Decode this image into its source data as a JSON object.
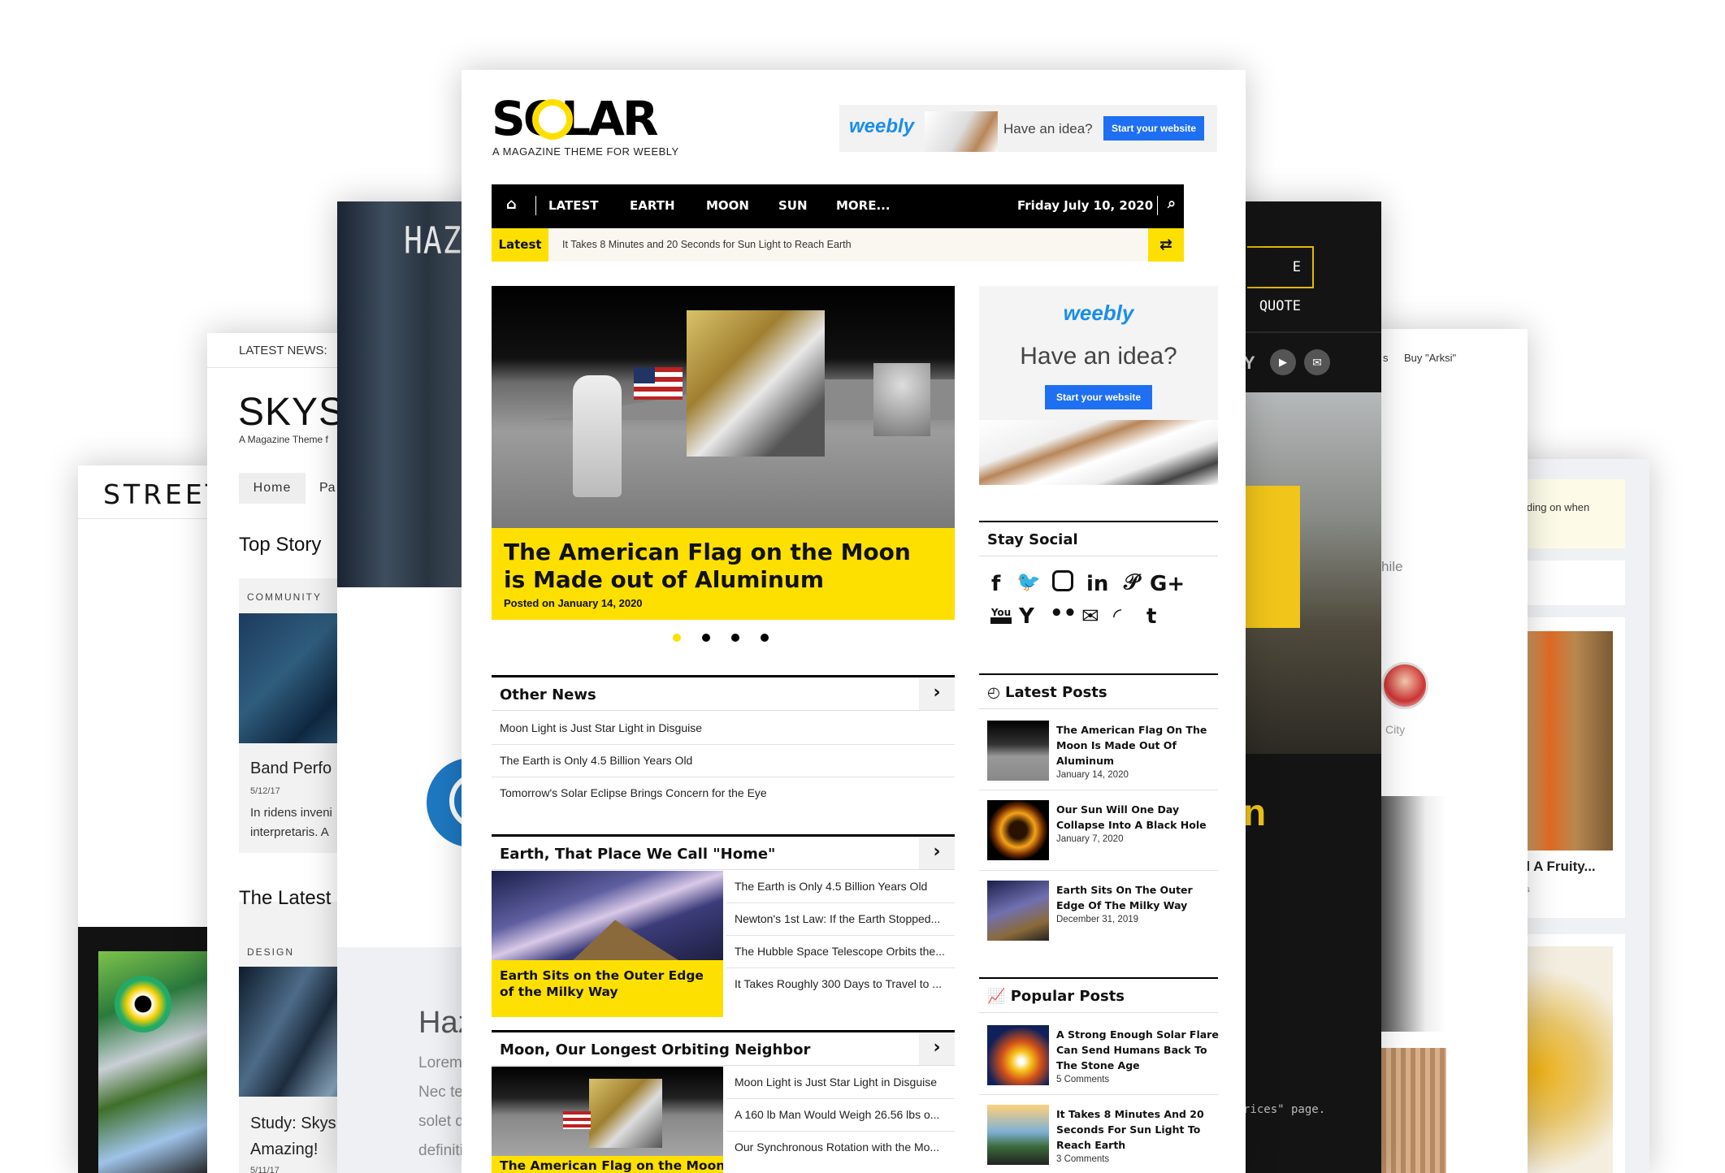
{
  "colors": {
    "accent": "#fde000",
    "dark": "#000000",
    "weebly_blue": "#1a8ee8",
    "button_blue": "#1f6ff2"
  },
  "solar": {
    "logo": "SOLAR",
    "tagline": "A MAGAZINE THEME FOR WEEBLY",
    "ad": {
      "brand": "weebly",
      "text": "Have an idea?",
      "button": "Start your website"
    },
    "nav": {
      "items": [
        "LATEST",
        "EARTH",
        "MOON",
        "SUN",
        "MORE..."
      ],
      "date": "Friday July 10, 2020",
      "home_icon": "home-icon",
      "search_icon": "search-icon"
    },
    "ticker": {
      "label": "Latest",
      "text": "It Takes 8 Minutes and 20 Seconds for Sun Light to Reach Earth",
      "shuffle_icon": "shuffle-icon"
    },
    "hero": {
      "title": "The American Flag on the Moon is Made out of Aluminum",
      "meta": "Posted on January 14, 2020"
    },
    "other_news": {
      "title": "Other News",
      "items": [
        "Moon Light is Just Star Light in Disguise",
        "The Earth is Only 4.5 Billion Years Old",
        "Tomorrow's Solar Eclipse Brings Concern for the Eye"
      ]
    },
    "earth": {
      "title": "Earth, That Place We Call \"Home\"",
      "feature": "Earth Sits on the Outer Edge of the Milky Way",
      "items": [
        "The Earth is Only 4.5 Billion Years Old",
        "Newton's 1st Law: If the Earth Stopped...",
        "The Hubble Space Telescope Orbits the...",
        "It Takes Roughly 300 Days to Travel to ..."
      ]
    },
    "moon": {
      "title": "Moon, Our Longest Orbiting Neighbor",
      "feature": "The American Flag on the Moon",
      "items": [
        "Moon Light is Just Star Light in Disguise",
        "A 160 lb Man Would Weigh 26.56 lbs o...",
        "Our Synchronous Rotation with the Mo..."
      ]
    },
    "side_ad": {
      "brand": "weebly",
      "text": "Have an idea?",
      "button": "Start your website"
    },
    "stay_social": {
      "title": "Stay Social"
    },
    "latest_posts": {
      "title": "Latest Posts",
      "items": [
        {
          "title": "The American Flag On The Moon Is Made Out Of Aluminum",
          "date": "January 14, 2020"
        },
        {
          "title": "Our Sun Will One Day Collapse Into A Black Hole",
          "date": "January 7, 2020"
        },
        {
          "title": "Earth Sits On The Outer Edge Of The Milky Way",
          "date": "December 31, 2019"
        }
      ]
    },
    "popular_posts": {
      "title": "Popular Posts",
      "items": [
        {
          "title": "A Strong Enough Solar Flare Can Send Humans Back To The Stone Age",
          "meta": "5 Comments"
        },
        {
          "title": "It Takes 8 Minutes And 20 Seconds For Sun Light To Reach Earth",
          "meta": "3 Comments"
        }
      ]
    }
  },
  "street": {
    "logo": "STREET"
  },
  "skys": {
    "latest_news": "LATEST NEWS:",
    "logo": "SKYS",
    "tagline": "A Magazine Theme f",
    "nav_home": "Home",
    "nav_pa": "Pa",
    "top_story": "Top Story",
    "cat1": "COMMUNITY",
    "post1_title": "Band Perfo",
    "post1_date": "5/12/17",
    "post1_text": "In ridens inveni",
    "post1_text2": "interpretaris. A",
    "the_latest": "The Latest",
    "cat2": "DESIGN",
    "post2_title": "Study: Skys",
    "post2_title2": "Amazing!",
    "post2_date": "5/11/17"
  },
  "haze": {
    "logo": "HAZE",
    "title": "Haze",
    "l1": "Lorem i",
    "l2": "Nec te e",
    "l3": "solet dic",
    "l4": "definitio"
  },
  "right_dark": {
    "quote_btn": "E QUOTE",
    "y": "Y",
    "big_letter": "n",
    "pricing": "rices\" page."
  },
  "right_white": {
    "buy": "Buy \"Arksi\"",
    "s": "s",
    "hile": "hile",
    "city": "City"
  },
  "far_right": {
    "snippet": "epending on when",
    "add_title": "Add A Fruity...",
    "comments": "nments"
  }
}
